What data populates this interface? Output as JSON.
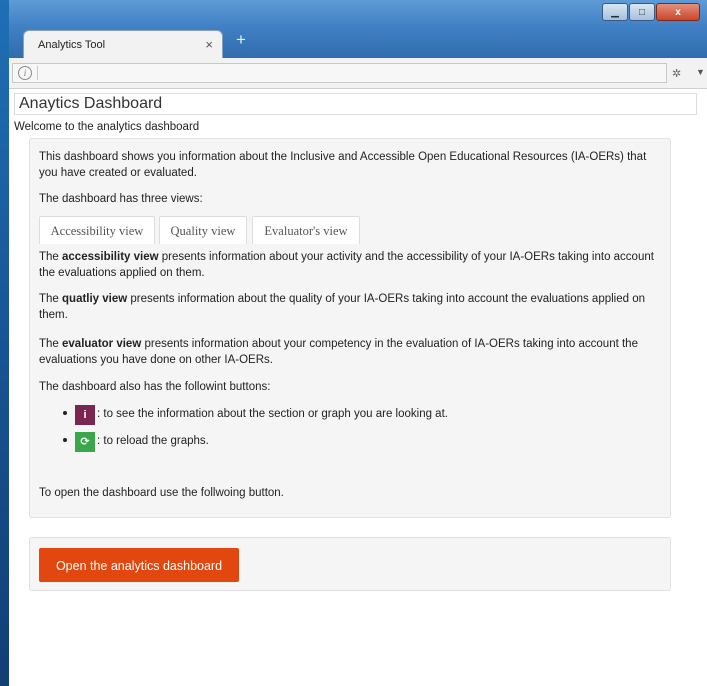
{
  "browser": {
    "tab_title": "Analytics Tool",
    "tab_close": "×",
    "new_tab": "+",
    "info_glyph": "i",
    "window_controls": {
      "minimize": "▁",
      "maximize": "□",
      "close": "x"
    },
    "ext_glyph": "✲",
    "menu_glyph": "▼",
    "icons": [
      "info-icon",
      "extension-icon",
      "menu-icon",
      "minimize-icon",
      "maximize-icon",
      "close-icon"
    ]
  },
  "page": {
    "title": "Anaytics Dashboard",
    "welcome": "Welcome to the analytics dashboard",
    "intro": "This dashboard shows you information about the Inclusive and Accessible Open Educational Resources (IA-OERs) that you have created or evaluated.",
    "three_views": "The dashboard has three views:",
    "view_tabs": [
      "Accessibility view",
      "Quality view",
      "Evaluator's view"
    ],
    "accessibility": {
      "lead": "The ",
      "bold": "accessibility view",
      "rest": " presents information about your activity and the accessibility of your IA-OERs taking into account the evaluations applied on them."
    },
    "quality": {
      "lead": "The ",
      "bold": "quatliy view",
      "rest": " presents information about the quality of your IA-OERs taking into account the evaluations applied on them."
    },
    "evaluator": {
      "lead": "The ",
      "bold": "evaluator view",
      "rest": " presents information about your competency in the evaluation of IA-OERs taking into account the evaluations you have done on other IA-OERs."
    },
    "buttons_intro": "The dashboard also has the followint buttons:",
    "bullets": [
      {
        "icon": "info-circle-icon",
        "glyph": "i",
        "color": "#7b2650",
        "text": ": to see the information about the section or graph you are looking at."
      },
      {
        "icon": "refresh-icon",
        "glyph": "⟳",
        "color": "#3aa84a",
        "text": ": to reload the graphs."
      }
    ],
    "open_intro": "To open the dashboard use the follwoing button.",
    "open_button": "Open the analytics dashboard",
    "accent": "#e1470f"
  }
}
